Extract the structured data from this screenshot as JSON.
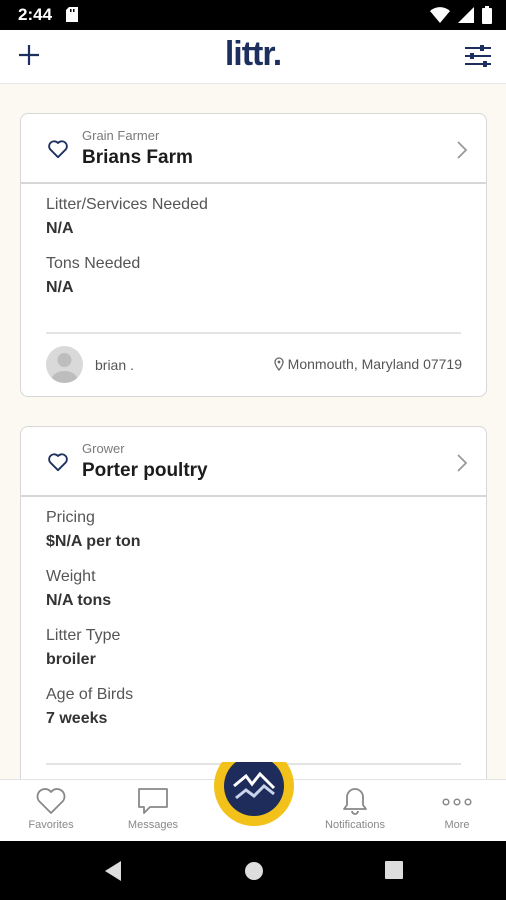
{
  "status": {
    "time": "2:44"
  },
  "app": {
    "logo": "littr."
  },
  "cards": [
    {
      "role": "Grain Farmer",
      "name": "Brians Farm",
      "fields": [
        {
          "label": "Litter/Services Needed",
          "value": "N/A"
        },
        {
          "label": "Tons Needed",
          "value": "N/A"
        }
      ],
      "user": "brian .",
      "location": "Monmouth, Maryland 07719"
    },
    {
      "role": "Grower",
      "name": "Porter poultry",
      "fields": [
        {
          "label": "Pricing",
          "value": "$N/A per ton"
        },
        {
          "label": "Weight",
          "value": "N/A tons"
        },
        {
          "label": "Litter Type",
          "value": "broiler"
        },
        {
          "label": "Age of Birds",
          "value": "7 weeks"
        }
      ]
    }
  ],
  "tabs": {
    "favorites": "Favorites",
    "messages": "Messages",
    "notifications": "Notifications",
    "more": "More"
  },
  "colors": {
    "brand": "#1c2f5e",
    "accent": "#f2c21b",
    "background": "#fbf9f2"
  }
}
